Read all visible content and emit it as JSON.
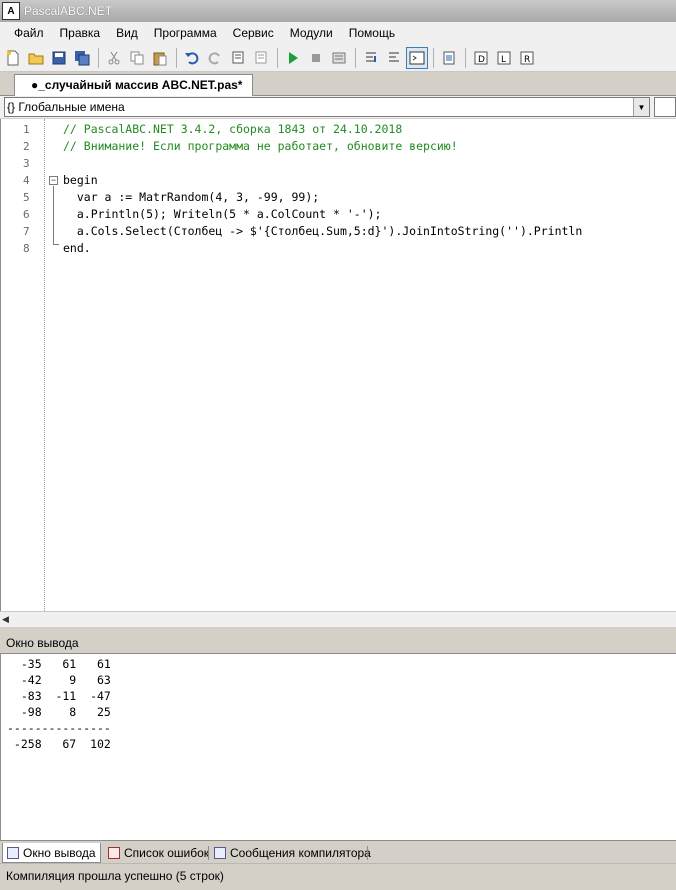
{
  "window": {
    "title": "PascalABC.NET",
    "app_icon": "abc-logo-icon"
  },
  "menu": {
    "items": [
      "Файл",
      "Правка",
      "Вид",
      "Программа",
      "Сервис",
      "Модули",
      "Помощь"
    ]
  },
  "toolbar": {
    "buttons": [
      "new-file",
      "open",
      "save",
      "save-all",
      "cut",
      "copy",
      "paste",
      "undo",
      "redo",
      "find",
      "replace",
      "run",
      "stop",
      "debug",
      "step-into",
      "step-over",
      "console",
      "watch",
      "format",
      "format-code",
      "refresh"
    ]
  },
  "document_tab": {
    "label": "●_случайный массив ABC.NET.pas*"
  },
  "globals_combo": {
    "value": "{} Глобальные имена"
  },
  "editor": {
    "line_numbers": [
      "1",
      "2",
      "3",
      "4",
      "5",
      "6",
      "7",
      "8"
    ],
    "lines": [
      "// PascalABC.NET 3.4.2, сборка 1843 от 24.10.2018",
      "// Внимание! Если программа не работает, обновите версию!",
      "",
      "begin",
      "  var a := MatrRandom(4, 3, -99, 99);",
      "  a.Println(5); Writeln(5 * a.ColCount * '-');",
      "  a.Cols.Select(Столбец -> $'{Столбец.Sum,5:d}').JoinIntoString('').Println",
      "end."
    ]
  },
  "output_pane": {
    "header": "Окно вывода",
    "lines": [
      "  -35   61   61",
      "  -42    9   63",
      "  -83  -11  -47",
      "  -98    8   25",
      "---------------",
      " -258   67  102"
    ]
  },
  "bottom_tabs": [
    {
      "label": "Окно вывода",
      "active": true
    },
    {
      "label": "Список ошибок",
      "active": false
    },
    {
      "label": "Сообщения компилятора",
      "active": false
    }
  ],
  "status": {
    "text": "Компиляция прошла успешно (5 строк)"
  }
}
